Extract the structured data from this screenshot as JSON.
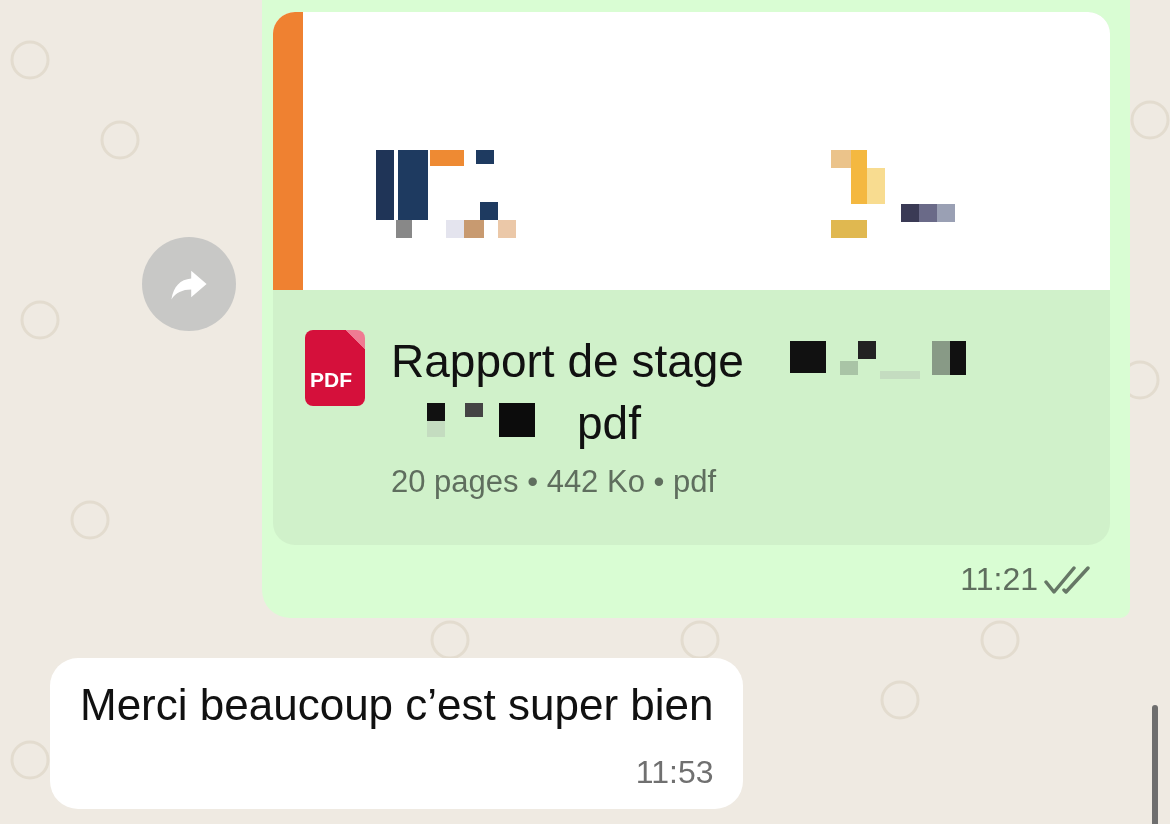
{
  "messages": [
    {
      "kind": "document",
      "badge": "PDF",
      "title_line_1": "Rapport de stage",
      "title_line_2": "pdf",
      "details": "20 pages • 442 Ko • pdf",
      "time": "11:21",
      "read": false
    },
    {
      "kind": "text",
      "text": "Merci beaucoup c’est super bien",
      "time": "11:53"
    }
  ]
}
